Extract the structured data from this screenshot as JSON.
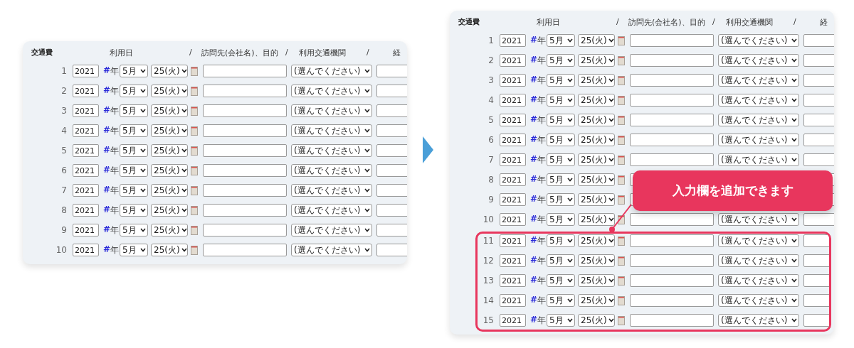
{
  "panels": [
    {
      "title": "交通費",
      "headers": [
        "利用日",
        "/",
        "訪問先(会社名)、目的",
        "/",
        "利用交通機関",
        "/",
        "経"
      ],
      "rows": [
        {
          "number": "1",
          "year": "2021",
          "mark": "#",
          "unit": "年",
          "month": "5月",
          "day": "25(火)",
          "transport": "(選んでください)"
        },
        {
          "number": "2",
          "year": "2021",
          "mark": "#",
          "unit": "年",
          "month": "5月",
          "day": "25(火)",
          "transport": "(選んでください)"
        },
        {
          "number": "3",
          "year": "2021",
          "mark": "#",
          "unit": "年",
          "month": "5月",
          "day": "25(火)",
          "transport": "(選んでください)"
        },
        {
          "number": "4",
          "year": "2021",
          "mark": "#",
          "unit": "年",
          "month": "5月",
          "day": "25(火)",
          "transport": "(選んでください)"
        },
        {
          "number": "5",
          "year": "2021",
          "mark": "#",
          "unit": "年",
          "month": "5月",
          "day": "25(火)",
          "transport": "(選んでください)"
        },
        {
          "number": "6",
          "year": "2021",
          "mark": "#",
          "unit": "年",
          "month": "5月",
          "day": "25(火)",
          "transport": "(選んでください)"
        },
        {
          "number": "7",
          "year": "2021",
          "mark": "#",
          "unit": "年",
          "month": "5月",
          "day": "25(火)",
          "transport": "(選んでください)"
        },
        {
          "number": "8",
          "year": "2021",
          "mark": "#",
          "unit": "年",
          "month": "5月",
          "day": "25(火)",
          "transport": "(選んでください)"
        },
        {
          "number": "9",
          "year": "2021",
          "mark": "#",
          "unit": "年",
          "month": "5月",
          "day": "25(火)",
          "transport": "(選んでください)"
        },
        {
          "number": "10",
          "year": "2021",
          "mark": "#",
          "unit": "年",
          "month": "5月",
          "day": "25(火)",
          "transport": "(選んでください)"
        }
      ]
    },
    {
      "title": "交通費",
      "headers": [
        "利用日",
        "/",
        "訪問先(会社名)、目的",
        "/",
        "利用交通機関",
        "/",
        "経"
      ],
      "rows": [
        {
          "number": "1",
          "year": "2021",
          "mark": "#",
          "unit": "年",
          "month": "5月",
          "day": "25(火)",
          "transport": "(選んでください)"
        },
        {
          "number": "2",
          "year": "2021",
          "mark": "#",
          "unit": "年",
          "month": "5月",
          "day": "25(火)",
          "transport": "(選んでください)"
        },
        {
          "number": "3",
          "year": "2021",
          "mark": "#",
          "unit": "年",
          "month": "5月",
          "day": "25(火)",
          "transport": "(選んでください)"
        },
        {
          "number": "4",
          "year": "2021",
          "mark": "#",
          "unit": "年",
          "month": "5月",
          "day": "25(火)",
          "transport": "(選んでください)"
        },
        {
          "number": "5",
          "year": "2021",
          "mark": "#",
          "unit": "年",
          "month": "5月",
          "day": "25(火)",
          "transport": "(選んでください)"
        },
        {
          "number": "6",
          "year": "2021",
          "mark": "#",
          "unit": "年",
          "month": "5月",
          "day": "25(火)",
          "transport": "(選んでください)"
        },
        {
          "number": "7",
          "year": "2021",
          "mark": "#",
          "unit": "年",
          "month": "5月",
          "day": "25(火)",
          "transport": "(選んでください)"
        },
        {
          "number": "8",
          "year": "2021",
          "mark": "#",
          "unit": "年",
          "month": "5月",
          "day": "25(火)"
        },
        {
          "number": "9",
          "year": "2021",
          "mark": "#",
          "unit": "年",
          "month": "5月",
          "day": "25(火)"
        },
        {
          "number": "10",
          "year": "2021",
          "mark": "#",
          "unit": "年",
          "month": "5月",
          "day": "25(火)",
          "transport": "(選んでください)"
        }
      ],
      "added_rows": [
        {
          "number": "11",
          "year": "2021",
          "mark": "#",
          "unit": "年",
          "month": "5月",
          "day": "25(火)",
          "transport": "(選んでください)"
        },
        {
          "number": "12",
          "year": "2021",
          "mark": "#",
          "unit": "年",
          "month": "5月",
          "day": "25(火)",
          "transport": "(選んでください)"
        },
        {
          "number": "13",
          "year": "2021",
          "mark": "#",
          "unit": "年",
          "month": "5月",
          "day": "25(火)",
          "transport": "(選んでください)"
        },
        {
          "number": "14",
          "year": "2021",
          "mark": "#",
          "unit": "年",
          "month": "5月",
          "day": "25(火)",
          "transport": "(選んでください)"
        },
        {
          "number": "15",
          "year": "2021",
          "mark": "#",
          "unit": "年",
          "month": "5月",
          "day": "25(火)",
          "transport": "(選んでください)"
        }
      ],
      "callout": {
        "text": "入力欄を追加できます"
      }
    }
  ]
}
